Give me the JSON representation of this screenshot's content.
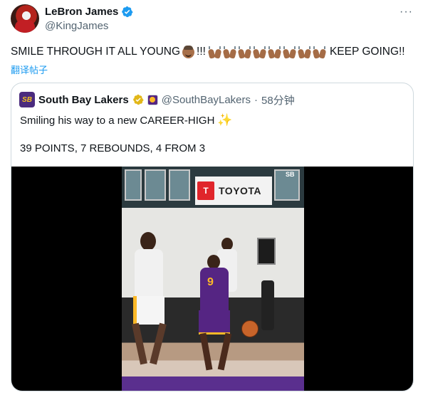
{
  "author": {
    "display_name": "LeBron James",
    "handle": "@KingJames"
  },
  "tweet": {
    "text_before_emoji": "SMILE THROUGH IT ALL YOUNG",
    "text_after_face": "!!!",
    "praise_hands_count": 8,
    "text_end": "KEEP GOING!!",
    "translate_label": "翻译帖子",
    "more_label": "···"
  },
  "quoted": {
    "logo_text": "SB",
    "display_name": "South Bay Lakers",
    "handle": "@SouthBayLakers",
    "separator": "·",
    "time": "58分钟",
    "line1": "Smiling his way to a new CAREER-HIGH",
    "line1_emoji": "✨",
    "line2": "39 POINTS, 7 REBOUNDS, 4 FROM 3"
  },
  "media": {
    "sponsor_text": "TOYOTA",
    "watermark": "SB",
    "jersey_number": "9"
  },
  "colors": {
    "verified_blue": "#1d9bf0",
    "gold_badge": "#e2b719",
    "lakers_purple": "#552583",
    "lakers_gold": "#fdb927"
  }
}
